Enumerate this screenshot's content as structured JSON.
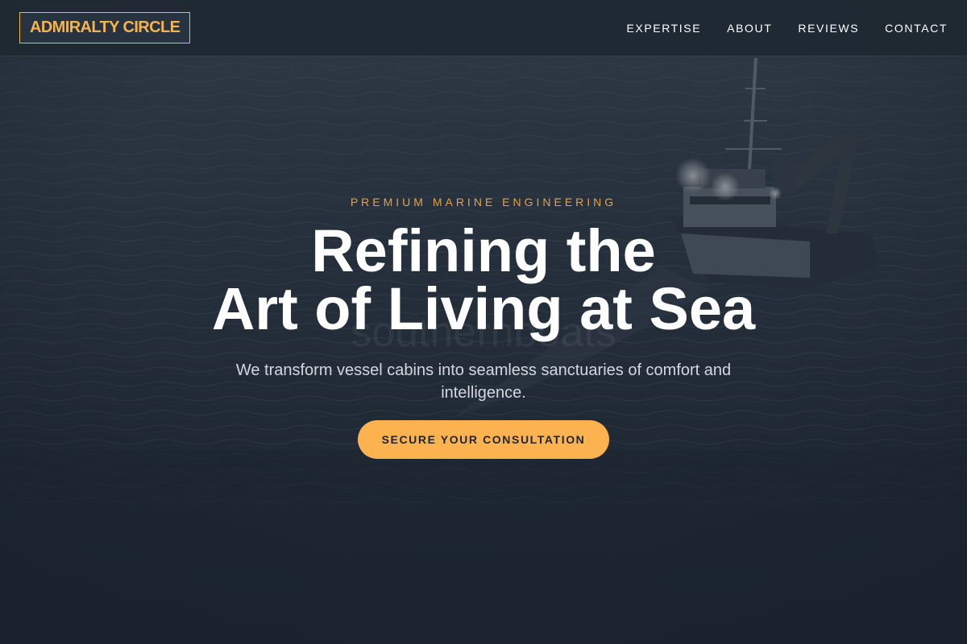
{
  "brand": {
    "logo_text": "ADMIRALTY CIRCLE",
    "accent_color": "#f4b350"
  },
  "nav": {
    "links": [
      {
        "label": "EXPERTISE"
      },
      {
        "label": "ABOUT"
      },
      {
        "label": "REVIEWS"
      },
      {
        "label": "CONTACT"
      }
    ]
  },
  "hero": {
    "eyebrow": "PREMIUM MARINE ENGINEERING",
    "headline_line1": "Refining the",
    "headline_line2": "Art of Living at Sea",
    "subhead": "We transform vessel cabins into seamless sanctuaries of comfort and intelligence.",
    "cta_label": "SECURE YOUR CONSULTATION",
    "cta_color": "#fcb24f",
    "watermark_text": "southernboats",
    "background_image": "ship-at-sea-photo"
  }
}
